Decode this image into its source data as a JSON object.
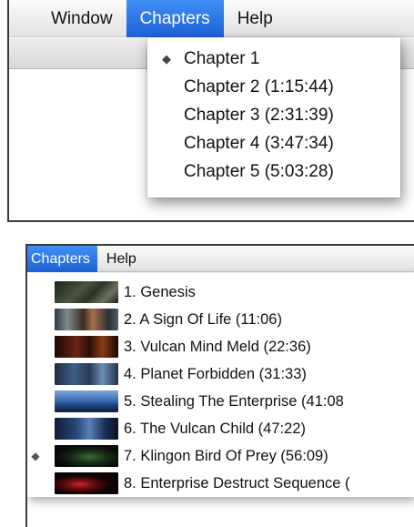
{
  "top_screenshot": {
    "menubar": {
      "items": [
        {
          "label": "Window",
          "active": false
        },
        {
          "label": "Chapters",
          "active": true
        },
        {
          "label": "Help",
          "active": false
        }
      ]
    },
    "dropdown": {
      "items": [
        {
          "label": "Chapter 1",
          "checked": true
        },
        {
          "label": "Chapter 2 (1:15:44)",
          "checked": false
        },
        {
          "label": "Chapter 3 (2:31:39)",
          "checked": false
        },
        {
          "label": "Chapter 4 (3:47:34)",
          "checked": false
        },
        {
          "label": "Chapter 5 (5:03:28)",
          "checked": false
        }
      ],
      "check_mark": "◆"
    }
  },
  "bottom_screenshot": {
    "menubar": {
      "items": [
        {
          "label": "Chapters",
          "active": true
        },
        {
          "label": "Help",
          "active": false
        }
      ]
    },
    "chapter_list": {
      "check_mark": "◆",
      "items": [
        {
          "label": "1. Genesis",
          "checked": false
        },
        {
          "label": "2. A Sign Of Life (11:06)",
          "checked": false
        },
        {
          "label": "3. Vulcan Mind Meld (22:36)",
          "checked": false
        },
        {
          "label": "4. Planet Forbidden (31:33)",
          "checked": false
        },
        {
          "label": "5. Stealing The Enterprise (41:08",
          "checked": false
        },
        {
          "label": "6. The Vulcan Child (47:22)",
          "checked": false
        },
        {
          "label": "7. Klingon Bird Of Prey (56:09)",
          "checked": true
        },
        {
          "label": "8. Enterprise Destruct Sequence (",
          "checked": false
        }
      ]
    }
  },
  "colors": {
    "menu_highlight": "#1d62d6",
    "menu_text": "#111111",
    "highlight_text": "#ffffff"
  }
}
